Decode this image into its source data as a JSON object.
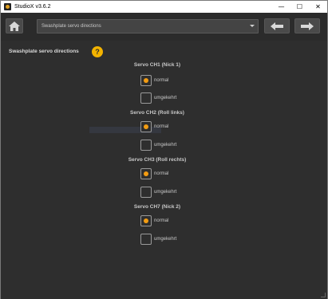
{
  "window": {
    "title": "StudioX v3.6.2",
    "minimize_glyph": "—",
    "maximize_glyph": "☐",
    "close_glyph": "✕"
  },
  "toolbar": {
    "home_icon": "home-icon",
    "back_icon": "arrow-left-icon",
    "forward_icon": "arrow-right-icon",
    "page_select": {
      "value": "Swashplate servo directions"
    }
  },
  "page": {
    "title": "Swashplate servo directions",
    "help_glyph": "?"
  },
  "servos": [
    {
      "heading": "Servo CH1 (Nick 1)",
      "options": [
        {
          "label": "normal",
          "selected": true
        },
        {
          "label": "umgekehrt",
          "selected": false
        }
      ]
    },
    {
      "heading": "Servo CH2 (Roll links)",
      "options": [
        {
          "label": "normal",
          "selected": true
        },
        {
          "label": "umgekehrt",
          "selected": false
        }
      ]
    },
    {
      "heading": "Servo CH3 (Roll rechts)",
      "options": [
        {
          "label": "normal",
          "selected": true
        },
        {
          "label": "umgekehrt",
          "selected": false
        }
      ]
    },
    {
      "heading": "Servo CH7 (Nick 2)",
      "options": [
        {
          "label": "normal",
          "selected": true
        },
        {
          "label": "umgekehrt",
          "selected": false
        }
      ]
    }
  ],
  "colors": {
    "accent": "#f39c12",
    "help": "#f3b300",
    "background": "#2e2e2e",
    "toolbar_button": "#4a4a4a"
  }
}
